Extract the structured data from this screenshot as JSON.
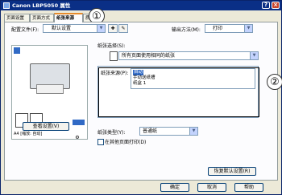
{
  "window": {
    "title": "Canon LBP5050 属性"
  },
  "tabs": [
    {
      "label": "页面设置"
    },
    {
      "label": "页面方式"
    },
    {
      "label": "纸张来源"
    },
    {
      "label": "质量"
    }
  ],
  "config": {
    "label": "配置文件(F):",
    "value": "默认设置"
  },
  "output": {
    "label": "输出方法(M):",
    "value": "打印"
  },
  "paper_selection": {
    "label": "纸张选择(S):",
    "value": "所有页面使用相同的纸张"
  },
  "paper_source": {
    "label": "纸张来源(P):",
    "options": [
      {
        "label": "自动",
        "selected": true
      },
      {
        "label": "手动送纸槽",
        "selected": false
      },
      {
        "label": "纸盒 1",
        "selected": false
      }
    ]
  },
  "paper_type": {
    "label": "纸张类型(Y):",
    "value": "普通纸"
  },
  "print_other_side": {
    "label": "在其他页面打印(D)",
    "checked": false
  },
  "preview": {
    "paper_info": "A4 [缩放: 自动]",
    "view_settings_button": "查看设置(V)"
  },
  "restore_defaults_button": "恢复默认设置(R)",
  "footer": {
    "ok": "确定",
    "cancel": "取消",
    "help": "帮助"
  },
  "callouts": [
    "①",
    "②"
  ],
  "colors": {
    "titlebar": "#0a2f86",
    "selected": "#316ac5",
    "tab_highlight": "#e68b2c"
  }
}
